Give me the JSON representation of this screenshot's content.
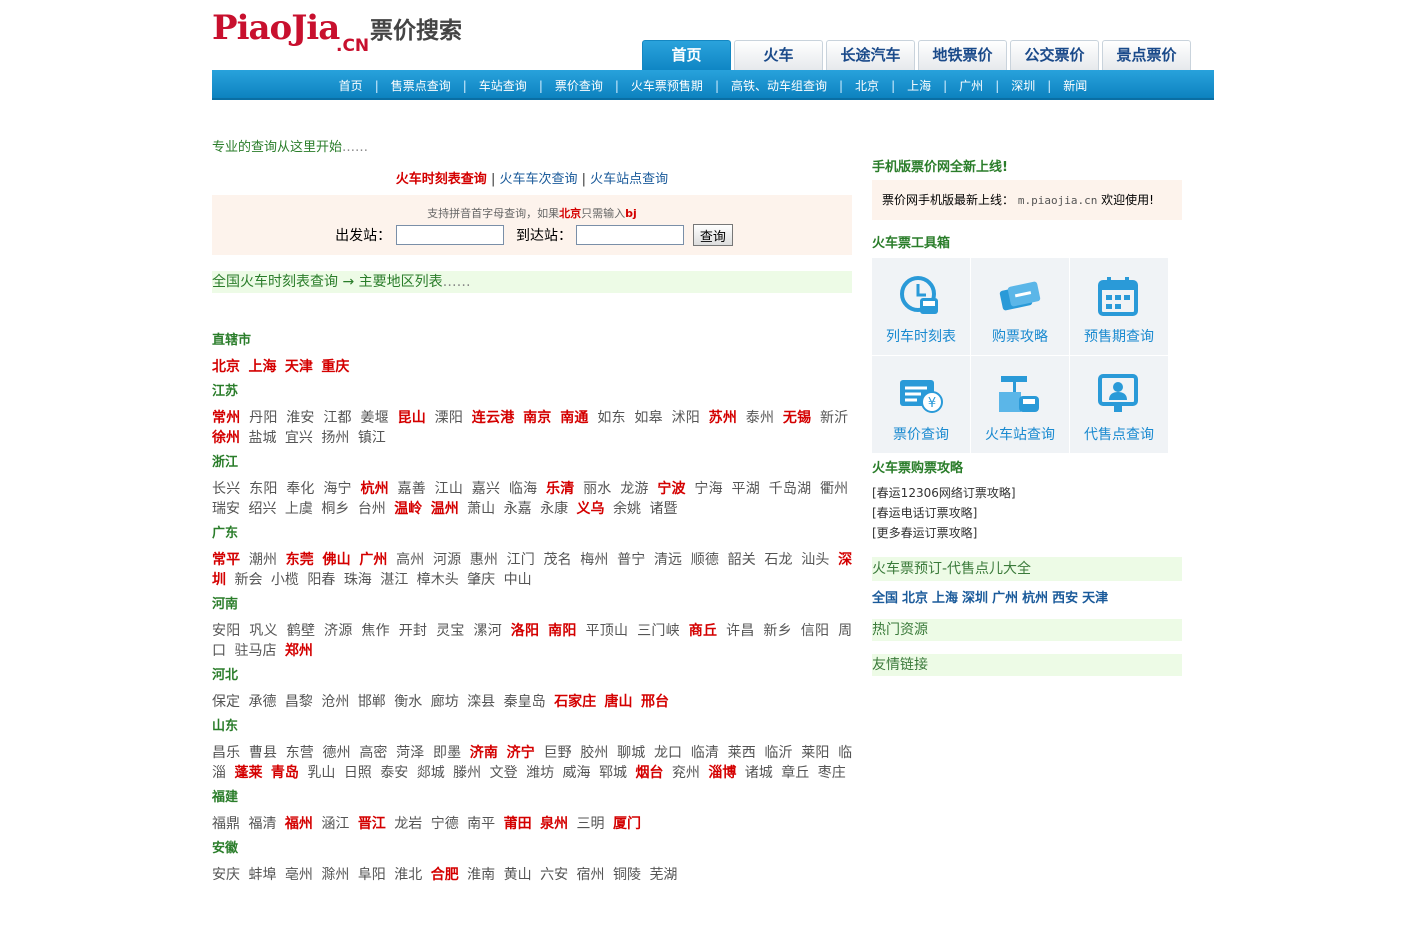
{
  "logo": {
    "text": "PiaoJia",
    "cn": ".CN",
    "slogan": "票价搜索"
  },
  "tabs": [
    "首页",
    "火车",
    "长途汽车",
    "地铁票价",
    "公交票价",
    "景点票价"
  ],
  "subnav": [
    "首页",
    "售票点查询",
    "车站查询",
    "票价查询",
    "火车票预售期",
    "高铁、动车组查询",
    "北京",
    "上海",
    "广州",
    "深圳",
    "新闻"
  ],
  "main": {
    "intro": "专业的查询从这里开始",
    "intro_dots": "……",
    "query_tabs": [
      "火车时刻表查询",
      "火车车次查询",
      "火车站点查询"
    ],
    "query_sep": "|",
    "hint_prefix": "支持拼音首字母查询，如果",
    "hint_city": "北京",
    "hint_mid": "只需输入",
    "hint_code": "bj",
    "from_label": "出发站：",
    "to_label": "到达站：",
    "search_button": "查询",
    "section_title": "全国火车时刻表查询 → 主要地区列表",
    "section_dots": "……"
  },
  "regions": [
    {
      "name": "直辖市",
      "cities": [
        [
          "北京",
          1
        ],
        [
          "上海",
          1
        ],
        [
          "天津",
          1
        ],
        [
          "重庆",
          1
        ]
      ]
    },
    {
      "name": "江苏",
      "cities": [
        [
          "常州",
          1
        ],
        [
          "丹阳",
          0
        ],
        [
          "淮安",
          0
        ],
        [
          "江都",
          0
        ],
        [
          "姜堰",
          0
        ],
        [
          "昆山",
          1
        ],
        [
          "溧阳",
          0
        ],
        [
          "连云港",
          1
        ],
        [
          "南京",
          1
        ],
        [
          "南通",
          1
        ],
        [
          "如东",
          0
        ],
        [
          "如皋",
          0
        ],
        [
          "沭阳",
          0
        ],
        [
          "苏州",
          1
        ],
        [
          "泰州",
          0
        ],
        [
          "无锡",
          1
        ],
        [
          "新沂",
          0
        ],
        [
          "徐州",
          1
        ],
        [
          "盐城",
          0
        ],
        [
          "宜兴",
          0
        ],
        [
          "扬州",
          0
        ],
        [
          "镇江",
          0
        ]
      ]
    },
    {
      "name": "浙江",
      "cities": [
        [
          "长兴",
          0
        ],
        [
          "东阳",
          0
        ],
        [
          "奉化",
          0
        ],
        [
          "海宁",
          0
        ],
        [
          "杭州",
          1
        ],
        [
          "嘉善",
          0
        ],
        [
          "江山",
          0
        ],
        [
          "嘉兴",
          0
        ],
        [
          "临海",
          0
        ],
        [
          "乐清",
          1
        ],
        [
          "丽水",
          0
        ],
        [
          "龙游",
          0
        ],
        [
          "宁波",
          1
        ],
        [
          "宁海",
          0
        ],
        [
          "平湖",
          0
        ],
        [
          "千岛湖",
          0
        ],
        [
          "衢州",
          0
        ],
        [
          "瑞安",
          0
        ],
        [
          "绍兴",
          0
        ],
        [
          "上虞",
          0
        ],
        [
          "桐乡",
          0
        ],
        [
          "台州",
          0
        ],
        [
          "温岭",
          1
        ],
        [
          "温州",
          1
        ],
        [
          "萧山",
          0
        ],
        [
          "永嘉",
          0
        ],
        [
          "永康",
          0
        ],
        [
          "义乌",
          1
        ],
        [
          "余姚",
          0
        ],
        [
          "诸暨",
          0
        ]
      ]
    },
    {
      "name": "广东",
      "cities": [
        [
          "常平",
          1
        ],
        [
          "潮州",
          0
        ],
        [
          "东莞",
          1
        ],
        [
          "佛山",
          1
        ],
        [
          "广州",
          1
        ],
        [
          "高州",
          0
        ],
        [
          "河源",
          0
        ],
        [
          "惠州",
          0
        ],
        [
          "江门",
          0
        ],
        [
          "茂名",
          0
        ],
        [
          "梅州",
          0
        ],
        [
          "普宁",
          0
        ],
        [
          "清远",
          0
        ],
        [
          "顺德",
          0
        ],
        [
          "韶关",
          0
        ],
        [
          "石龙",
          0
        ],
        [
          "汕头",
          0
        ],
        [
          "深圳",
          1
        ],
        [
          "新会",
          0
        ],
        [
          "小榄",
          0
        ],
        [
          "阳春",
          0
        ],
        [
          "珠海",
          0
        ],
        [
          "湛江",
          0
        ],
        [
          "樟木头",
          0
        ],
        [
          "肇庆",
          0
        ],
        [
          "中山",
          0
        ]
      ]
    },
    {
      "name": "河南",
      "cities": [
        [
          "安阳",
          0
        ],
        [
          "巩义",
          0
        ],
        [
          "鹤壁",
          0
        ],
        [
          "济源",
          0
        ],
        [
          "焦作",
          0
        ],
        [
          "开封",
          0
        ],
        [
          "灵宝",
          0
        ],
        [
          "漯河",
          0
        ],
        [
          "洛阳",
          1
        ],
        [
          "南阳",
          1
        ],
        [
          "平顶山",
          0
        ],
        [
          "三门峡",
          0
        ],
        [
          "商丘",
          1
        ],
        [
          "许昌",
          0
        ],
        [
          "新乡",
          0
        ],
        [
          "信阳",
          0
        ],
        [
          "周口",
          0
        ],
        [
          "驻马店",
          0
        ],
        [
          "郑州",
          1
        ]
      ]
    },
    {
      "name": "河北",
      "cities": [
        [
          "保定",
          0
        ],
        [
          "承德",
          0
        ],
        [
          "昌黎",
          0
        ],
        [
          "沧州",
          0
        ],
        [
          "邯郸",
          0
        ],
        [
          "衡水",
          0
        ],
        [
          "廊坊",
          0
        ],
        [
          "滦县",
          0
        ],
        [
          "秦皇岛",
          0
        ],
        [
          "石家庄",
          1
        ],
        [
          "唐山",
          1
        ],
        [
          "邢台",
          1
        ]
      ]
    },
    {
      "name": "山东",
      "cities": [
        [
          "昌乐",
          0
        ],
        [
          "曹县",
          0
        ],
        [
          "东营",
          0
        ],
        [
          "德州",
          0
        ],
        [
          "高密",
          0
        ],
        [
          "菏泽",
          0
        ],
        [
          "即墨",
          0
        ],
        [
          "济南",
          1
        ],
        [
          "济宁",
          1
        ],
        [
          "巨野",
          0
        ],
        [
          "胶州",
          0
        ],
        [
          "聊城",
          0
        ],
        [
          "龙口",
          0
        ],
        [
          "临清",
          0
        ],
        [
          "莱西",
          0
        ],
        [
          "临沂",
          0
        ],
        [
          "莱阳",
          0
        ],
        [
          "临淄",
          0
        ],
        [
          "蓬莱",
          1
        ],
        [
          "青岛",
          1
        ],
        [
          "乳山",
          0
        ],
        [
          "日照",
          0
        ],
        [
          "泰安",
          0
        ],
        [
          "郯城",
          0
        ],
        [
          "滕州",
          0
        ],
        [
          "文登",
          0
        ],
        [
          "潍坊",
          0
        ],
        [
          "威海",
          0
        ],
        [
          "郓城",
          0
        ],
        [
          "烟台",
          1
        ],
        [
          "兖州",
          0
        ],
        [
          "淄博",
          1
        ],
        [
          "诸城",
          0
        ],
        [
          "章丘",
          0
        ],
        [
          "枣庄",
          0
        ]
      ]
    },
    {
      "name": "福建",
      "cities": [
        [
          "福鼎",
          0
        ],
        [
          "福清",
          0
        ],
        [
          "福州",
          1
        ],
        [
          "涵江",
          0
        ],
        [
          "晋江",
          1
        ],
        [
          "龙岩",
          0
        ],
        [
          "宁德",
          0
        ],
        [
          "南平",
          0
        ],
        [
          "莆田",
          1
        ],
        [
          "泉州",
          1
        ],
        [
          "三明",
          0
        ],
        [
          "厦门",
          1
        ]
      ]
    },
    {
      "name": "安徽",
      "cities": [
        [
          "安庆",
          0
        ],
        [
          "蚌埠",
          0
        ],
        [
          "亳州",
          0
        ],
        [
          "滁州",
          0
        ],
        [
          "阜阳",
          0
        ],
        [
          "淮北",
          0
        ],
        [
          "合肥",
          1
        ],
        [
          "淮南",
          0
        ],
        [
          "黄山",
          0
        ],
        [
          "六安",
          0
        ],
        [
          "宿州",
          0
        ],
        [
          "铜陵",
          0
        ],
        [
          "芜湖",
          0
        ]
      ]
    }
  ],
  "side": {
    "mobile_title": "手机版票价网全新上线!",
    "mobile_text": "票价网手机版最新上线：",
    "mobile_url": "m.piaojia.cn",
    "mobile_suffix": "欢迎使用!",
    "toolbox_title": "火车票工具箱",
    "tools": [
      {
        "label": "列车时刻表",
        "icon": "clock-train-icon"
      },
      {
        "label": "购票攻略",
        "icon": "tickets-icon"
      },
      {
        "label": "预售期查询",
        "icon": "calendar-icon"
      },
      {
        "label": "票价查询",
        "icon": "price-yen-icon"
      },
      {
        "label": "火车站查询",
        "icon": "station-icon"
      },
      {
        "label": "代售点查询",
        "icon": "agent-icon"
      }
    ],
    "guide_title": "火车票购票攻略",
    "guides": [
      "[春运12306网络订票攻略]",
      "[春运电话订票攻略]",
      "[更多春运订票攻略]"
    ],
    "agents_title": "火车票预订-代售点儿大全",
    "agent_cities": [
      "全国",
      "北京",
      "上海",
      "深圳",
      "广州",
      "杭州",
      "西安",
      "天津"
    ],
    "hot_title": "热门资源",
    "links_title": "友情链接"
  },
  "colors": {
    "accent": "#0f86c4",
    "hot": "#d40000",
    "green": "#2a7d2a",
    "link": "#1a5a9a"
  }
}
